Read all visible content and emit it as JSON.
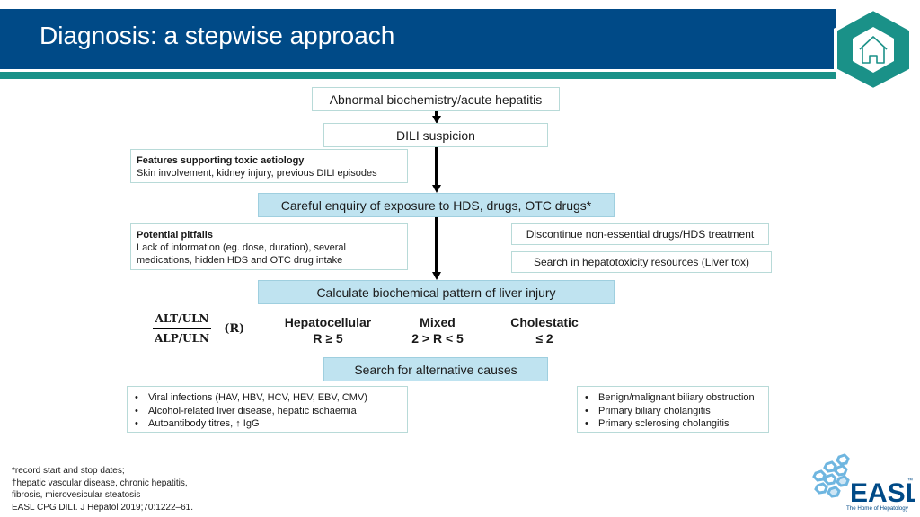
{
  "slide": {
    "title": "Diagnosis: a stepwise approach",
    "home_button_icon": "home-icon"
  },
  "flow": {
    "step1": "Abnormal biochemistry/acute hepatitis",
    "step2": "DILI suspicion",
    "step3": "Careful enquiry of exposure to HDS, drugs, OTC drugs*",
    "step4": "Calculate biochemical pattern of liver injury",
    "step5": "Search for alternative causes"
  },
  "side_notes": {
    "features": {
      "heading": "Features supporting toxic aetiology",
      "text": "Skin involvement, kidney injury, previous DILI episodes"
    },
    "pitfalls": {
      "heading": "Potential pitfalls",
      "text_line1": "Lack of information (eg. dose, duration), several",
      "text_line2": "medications, hidden HDS and OTC drug intake"
    },
    "actions": [
      "Discontinue non-essential drugs/HDS treatment",
      "Search in hepatotoxicity resources (Liver tox)"
    ]
  },
  "formula": {
    "numerator": "ALT/ULN",
    "denominator": "ALP/ULN",
    "label": "(R)"
  },
  "patterns": [
    {
      "name": "Hepatocellular",
      "criterion": "R ≥ 5"
    },
    {
      "name": "Mixed",
      "criterion": "2 > R < 5"
    },
    {
      "name": "Cholestatic",
      "criterion": "≤ 2"
    }
  ],
  "alternative_causes": {
    "hepatocellular": [
      "Viral infections (HAV, HBV, HCV, HEV, EBV, CMV)",
      "Alcohol-related liver disease, hepatic ischaemia",
      "Autoantibody titres, ↑ IgG"
    ],
    "cholestatic": [
      "Benign/malignant biliary obstruction",
      "Primary biliary cholangitis",
      "Primary sclerosing cholangitis"
    ]
  },
  "footnotes": [
    "*record start and stop dates;",
    "†hepatic vascular disease, chronic hepatitis,",
    "fibrosis, microvesicular steatosis",
    "EASL CPG DILI. J Hepatol 2019;70:1222–61."
  ],
  "logo": {
    "name": "EASL",
    "trademark": "™",
    "tagline": "The Home of Hepatology"
  },
  "colors": {
    "header_blue": "#004a87",
    "teal": "#1a9188",
    "box_blue": "#bfe3f0",
    "logo_light_blue": "#6fb6e0"
  }
}
